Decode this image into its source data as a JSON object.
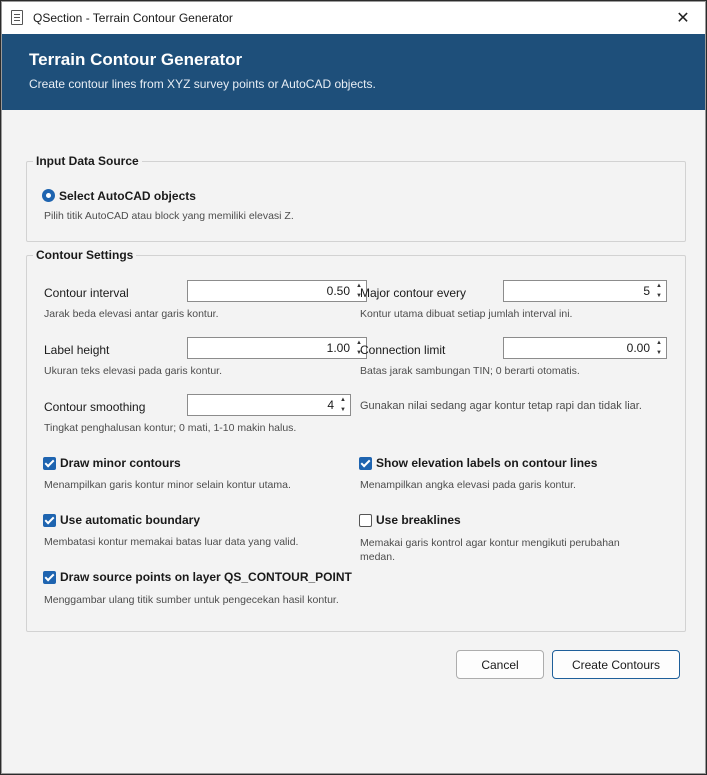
{
  "window": {
    "title": "QSection - Terrain Contour Generator",
    "close_glyph": "✕"
  },
  "header": {
    "title": "Terrain Contour Generator",
    "subtitle": "Create contour lines from XYZ survey points or AutoCAD objects."
  },
  "input_source": {
    "legend": "Input Data Source",
    "option_label": "Select AutoCAD objects",
    "option_hint": "Pilih titik AutoCAD atau block yang memiliki elevasi Z."
  },
  "contour_settings": {
    "legend": "Contour Settings",
    "contour_interval": {
      "label": "Contour interval",
      "value": "0.50",
      "hint": "Jarak beda elevasi antar garis kontur."
    },
    "major_contour": {
      "label": "Major contour every",
      "value": "5",
      "hint": "Kontur utama dibuat setiap jumlah interval ini."
    },
    "label_height": {
      "label": "Label height",
      "value": "1.00",
      "hint": "Ukuran teks elevasi pada garis kontur."
    },
    "connection_limit": {
      "label": "Connection limit",
      "value": "0.00",
      "hint": "Batas jarak sambungan TIN; 0 berarti otomatis."
    },
    "smoothing": {
      "label": "Contour smoothing",
      "value": "4",
      "side_hint": "Gunakan nilai sedang agar kontur tetap rapi dan tidak liar.",
      "hint": "Tingkat penghalusan kontur; 0 mati, 1-10 makin halus."
    },
    "draw_minor": {
      "label": "Draw minor contours",
      "checked": true,
      "hint": "Menampilkan garis kontur minor selain kontur utama."
    },
    "show_labels": {
      "label": "Show elevation labels on contour lines",
      "checked": true,
      "hint": "Menampilkan angka elevasi pada garis kontur."
    },
    "auto_boundary": {
      "label": "Use automatic boundary",
      "checked": true,
      "hint": "Membatasi kontur memakai batas luar data yang valid."
    },
    "breaklines": {
      "label": "Use breaklines",
      "checked": false,
      "hint_line1": "Memakai garis kontrol agar kontur mengikuti perubahan",
      "hint_line2": "medan."
    },
    "draw_source": {
      "label": "Draw source points on layer QS_CONTOUR_POINT",
      "checked": true,
      "hint": "Menggambar ulang titik sumber untuk pengecekan hasil kontur."
    }
  },
  "buttons": {
    "cancel": "Cancel",
    "create": "Create Contours"
  },
  "colors": {
    "header_bg": "#1e4f7a",
    "accent": "#1e64b0"
  }
}
